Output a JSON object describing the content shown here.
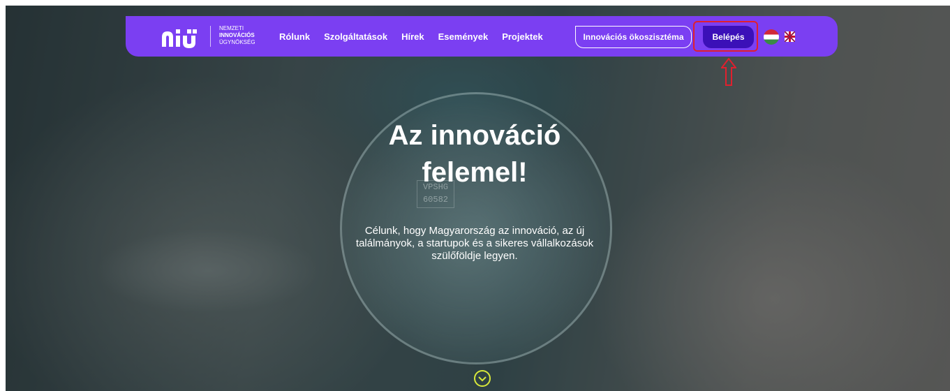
{
  "brand": {
    "mark": "ɑıij",
    "line1": "NEMZETI",
    "line2": "INNOVÁCIÓS",
    "line3": "ÜGYNÖKSÉG"
  },
  "nav": {
    "links": [
      "Rólunk",
      "Szolgáltatások",
      "Hírek",
      "Események",
      "Projektek"
    ],
    "ecosystem_label": "Innovációs ökoszisztéma",
    "login_label": "Belépés",
    "languages": [
      "hu",
      "en"
    ]
  },
  "hero": {
    "title_line1": "Az innováció",
    "title_line2": "felemel!",
    "subtitle": "Célunk, hogy Magyarország az innováció, az új találmányok, a startupok és a sikeres vállalkozások szülőföldje legyen.",
    "dish_label_line1": "VPSHG",
    "dish_label_line2": "60582"
  },
  "colors": {
    "nav_bg": "#7b3ff2",
    "login_bg": "#3b10b8",
    "highlight": "#e0202e",
    "scroll_ring": "#d9e93a"
  }
}
